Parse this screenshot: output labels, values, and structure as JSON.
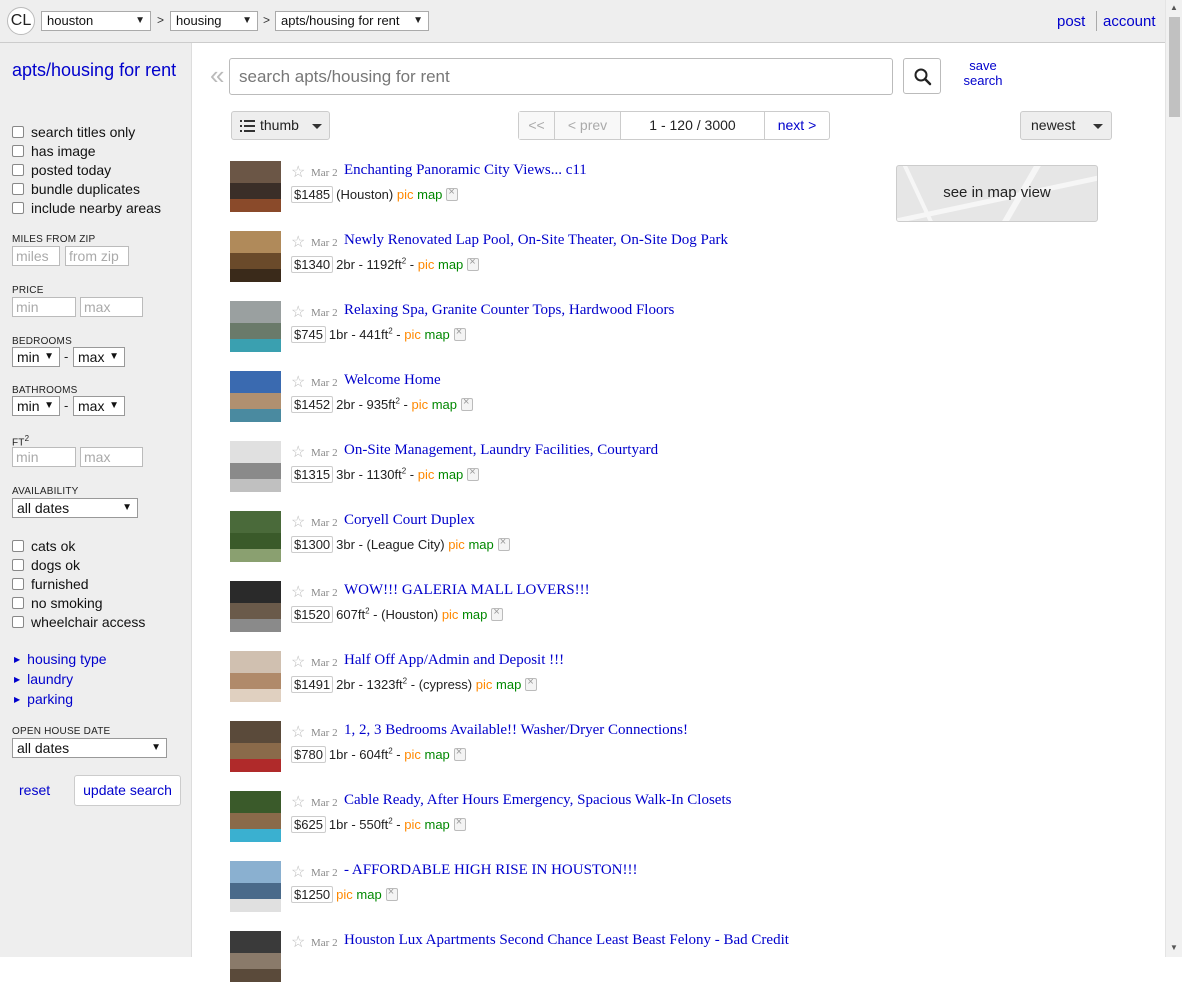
{
  "topbar": {
    "logo": "CL",
    "crumbs": [
      "houston",
      "housing",
      "apts/housing for rent"
    ],
    "sep": ">",
    "post": "post",
    "account": "account"
  },
  "sidebar": {
    "title": "apts/housing for rent",
    "checks_top": [
      "search titles only",
      "has image",
      "posted today",
      "bundle duplicates",
      "include nearby areas"
    ],
    "miles_label": "MILES FROM ZIP",
    "miles_placeholder": "miles",
    "zip_placeholder": "from zip",
    "price_label": "PRICE",
    "min_placeholder": "min",
    "max_placeholder": "max",
    "bedrooms_label": "BEDROOMS",
    "bathrooms_label": "BATHROOMS",
    "sel_min": "min",
    "sel_max": "max",
    "dash": "-",
    "ft_label": "FT",
    "ft_sup": "2",
    "availability_label": "AVAILABILITY",
    "availability_value": "all dates",
    "checks_bottom": [
      "cats ok",
      "dogs ok",
      "furnished",
      "no smoking",
      "wheelchair access"
    ],
    "links": [
      "housing type",
      "laundry",
      "parking"
    ],
    "openhouse_label": "OPEN HOUSE DATE",
    "openhouse_value": "all dates",
    "reset": "reset",
    "update": "update search"
  },
  "search": {
    "placeholder": "search apts/housing for rent",
    "save_line1": "save",
    "save_line2": "search"
  },
  "controls": {
    "view": "thumb",
    "first": "<<",
    "prev": "< prev",
    "range": "1 - 120 / 3000",
    "next": "next >",
    "sort": "newest"
  },
  "map": {
    "label": "see in map view"
  },
  "results": [
    {
      "date": "Mar 2",
      "title": "Enchanting Panoramic City Views... c11",
      "price": "$1485",
      "br": "",
      "sqft": "",
      "loc": "(Houston)",
      "colors": [
        "#6b5646",
        "#3a2e28",
        "#8a4a2a"
      ]
    },
    {
      "date": "Mar 2",
      "title": "Newly Renovated Lap Pool, On-Site Theater, On-Site Dog Park",
      "price": "$1340",
      "br": "2br",
      "sqft": "1192",
      "loc": "",
      "colors": [
        "#b08a5a",
        "#6a4a2a",
        "#3a2a1a"
      ]
    },
    {
      "date": "Mar 2",
      "title": "Relaxing Spa, Granite Counter Tops, Hardwood Floors",
      "price": "$745",
      "br": "1br",
      "sqft": "441",
      "loc": "",
      "colors": [
        "#9aa0a0",
        "#6a7a6a",
        "#3aa0b0"
      ]
    },
    {
      "date": "Mar 2",
      "title": "Welcome Home",
      "price": "$1452",
      "br": "2br",
      "sqft": "935",
      "loc": "",
      "colors": [
        "#3a6ab0",
        "#b09070",
        "#4a8aa0"
      ]
    },
    {
      "date": "Mar 2",
      "title": "On-Site Management, Laundry Facilities, Courtyard",
      "price": "$1315",
      "br": "3br",
      "sqft": "1130",
      "loc": "",
      "colors": [
        "#e0e0e0",
        "#8a8a8a",
        "#c0c0c0"
      ]
    },
    {
      "date": "Mar 2",
      "title": "Coryell Court Duplex",
      "price": "$1300",
      "br": "3br",
      "sqft": "",
      "loc": "(League City)",
      "colors": [
        "#4a6a3a",
        "#3a5a2a",
        "#8aa070"
      ]
    },
    {
      "date": "Mar 2",
      "title": "WOW!!! GALERIA MALL LOVERS!!!",
      "price": "$1520",
      "br": "",
      "sqft": "607",
      "loc": "(Houston)",
      "colors": [
        "#2a2a2a",
        "#6a5a4a",
        "#8a8a8a"
      ]
    },
    {
      "date": "Mar 2",
      "title": "Half Off App/Admin and Deposit !!!",
      "price": "$1491",
      "br": "2br",
      "sqft": "1323",
      "loc": "(cypress)",
      "colors": [
        "#d0c0b0",
        "#b08a6a",
        "#e0d0c0"
      ]
    },
    {
      "date": "Mar 2",
      "title": "1, 2, 3 Bedrooms Available!! Washer/Dryer Connections!",
      "price": "$780",
      "br": "1br",
      "sqft": "604",
      "loc": "",
      "colors": [
        "#5a4a3a",
        "#8a6a4a",
        "#b02a2a"
      ]
    },
    {
      "date": "Mar 2",
      "title": "Cable Ready, After Hours Emergency, Spacious Walk-In Closets",
      "price": "$625",
      "br": "1br",
      "sqft": "550",
      "loc": "",
      "colors": [
        "#3a5a2a",
        "#8a6a4a",
        "#3ab0d0"
      ]
    },
    {
      "date": "Mar 2",
      "title": "- AFFORDABLE HIGH RISE IN HOUSTON!!!",
      "price": "$1250",
      "br": "",
      "sqft": "",
      "loc": "",
      "colors": [
        "#8ab0d0",
        "#4a6a8a",
        "#e0e0e0"
      ]
    },
    {
      "date": "Mar 2",
      "title": "Houston Lux Apartments Second Chance Least Beast Felony - Bad Credit",
      "price": "",
      "br": "",
      "sqft": "",
      "loc": "",
      "colors": [
        "#3a3a3a",
        "#8a7a6a",
        "#5a4a3a"
      ]
    }
  ],
  "labels": {
    "pic": "pic",
    "map": "map",
    "ft_suffix": "ft",
    "ft_sup": "2",
    "dash": " - "
  },
  "colors": {
    "link": "#0000cc",
    "pic": "#ff8800",
    "map": "#008800",
    "sidebar_bg": "#eeeeee"
  }
}
